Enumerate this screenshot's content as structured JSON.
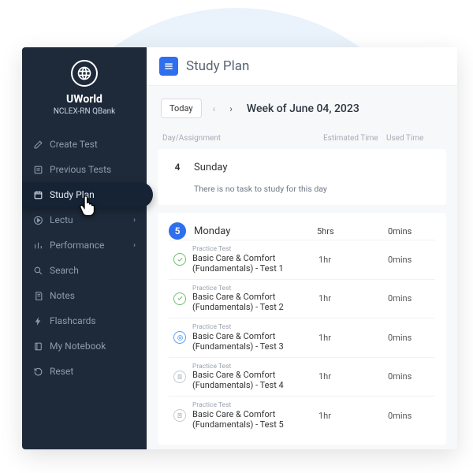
{
  "brand": {
    "name": "UWorld",
    "subtitle": "NCLEX-RN QBank"
  },
  "sidebar": {
    "items": [
      {
        "label": "Create Test"
      },
      {
        "label": "Previous Tests"
      },
      {
        "label": "Study Plan"
      },
      {
        "label": "Lectu"
      },
      {
        "label": "Performance"
      },
      {
        "label": "Search"
      },
      {
        "label": "Notes"
      },
      {
        "label": "Flashcards"
      },
      {
        "label": "My Notebook"
      },
      {
        "label": "Reset"
      }
    ]
  },
  "header": {
    "title": "Study Plan"
  },
  "toolbar": {
    "today": "Today",
    "week_label": "Week of June 04, 2023"
  },
  "columns": {
    "day": "Day/Assignment",
    "est": "Estimated Time",
    "used": "Used Time"
  },
  "days": [
    {
      "num": "4",
      "name": "Sunday",
      "empty_msg": "There is no task to study for this day"
    },
    {
      "num": "5",
      "name": "Monday",
      "est": "5hrs",
      "used": "0mins",
      "tasks": [
        {
          "type": "Practice Test",
          "title": "Basic Care & Comfort (Fundamentals) - Test 1",
          "est": "1hr",
          "used": "0mins"
        },
        {
          "type": "Practice Test",
          "title": "Basic Care & Comfort (Fundamentals) - Test 2",
          "est": "1hr",
          "used": "0mins"
        },
        {
          "type": "Practice Test",
          "title": "Basic Care & Comfort (Fundamentals) - Test 3",
          "est": "1hr",
          "used": "0mins"
        },
        {
          "type": "Practice Test",
          "title": "Basic Care & Comfort (Fundamentals) - Test 4",
          "est": "1hr",
          "used": "0mins"
        },
        {
          "type": "Practice Test",
          "title": "Basic Care & Comfort (Fundamentals) - Test 5",
          "est": "1hr",
          "used": "0mins"
        }
      ]
    }
  ]
}
